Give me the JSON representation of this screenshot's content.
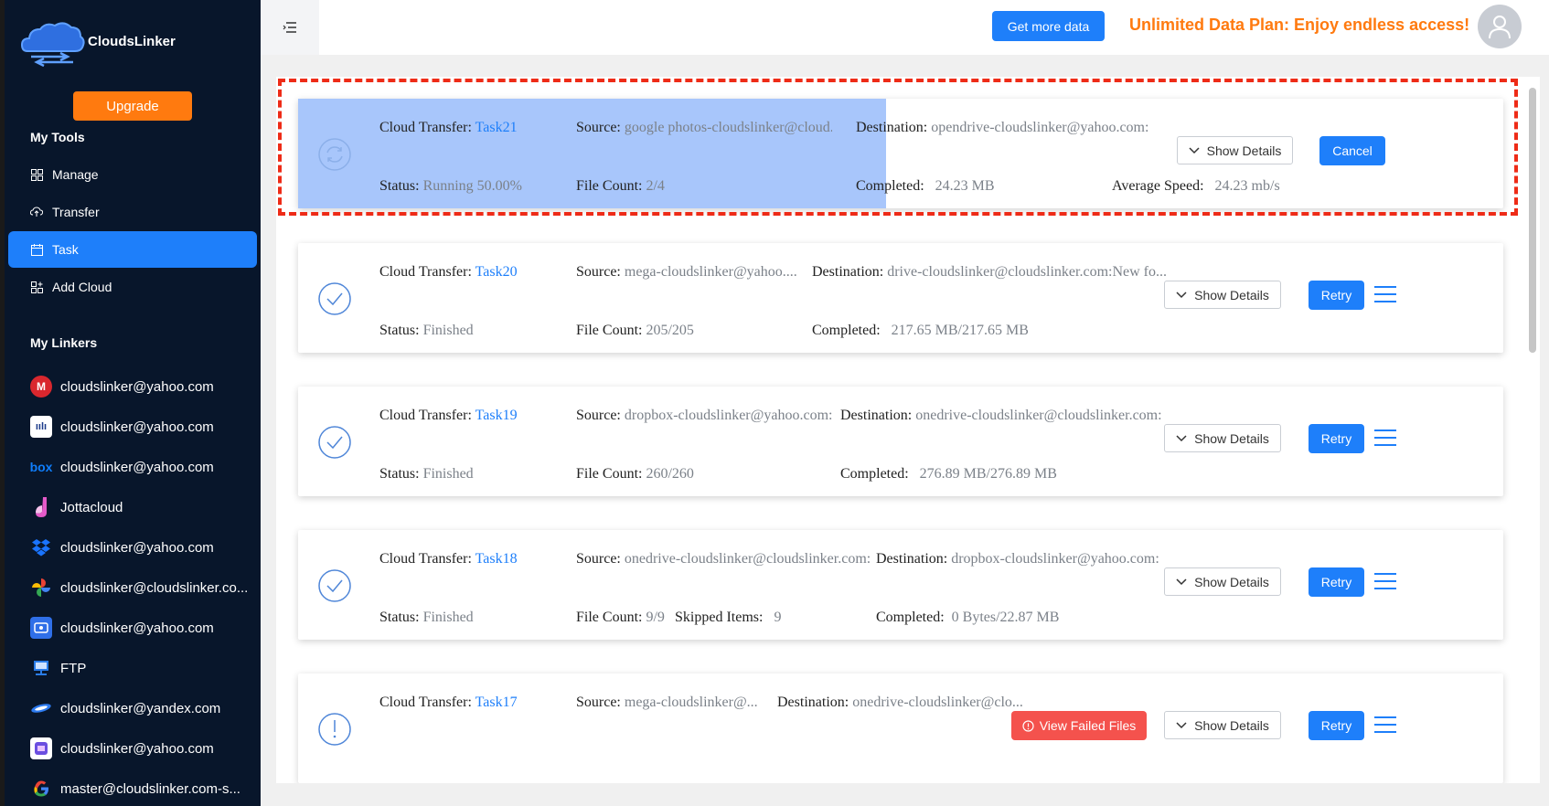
{
  "app": {
    "name": "CloudsLinker"
  },
  "sidebar": {
    "upgrade_label": "Upgrade",
    "tools_title": "My Tools",
    "tools": [
      {
        "label": "Manage",
        "icon": "grid-icon"
      },
      {
        "label": "Transfer",
        "icon": "cloud-transfer-icon"
      },
      {
        "label": "Task",
        "icon": "calendar-icon",
        "active": true
      },
      {
        "label": "Add Cloud",
        "icon": "add-grid-icon"
      }
    ],
    "linkers_title": "My Linkers",
    "linkers": [
      {
        "label": "cloudslinker@yahoo.com",
        "icon": "mega-icon"
      },
      {
        "label": "cloudslinker@yahoo.com",
        "icon": "pcloud-icon"
      },
      {
        "label": "cloudslinker@yahoo.com",
        "icon": "box-icon"
      },
      {
        "label": "Jottacloud",
        "icon": "jottacloud-icon"
      },
      {
        "label": "cloudslinker@yahoo.com",
        "icon": "dropbox-icon"
      },
      {
        "label": "cloudslinker@cloudslinker.co...",
        "icon": "google-photos-icon"
      },
      {
        "label": "cloudslinker@yahoo.com",
        "icon": "mediafire-icon"
      },
      {
        "label": "FTP",
        "icon": "ftp-icon"
      },
      {
        "label": "cloudslinker@yandex.com",
        "icon": "yandex-icon"
      },
      {
        "label": "cloudslinker@yahoo.com",
        "icon": "icedrive-icon"
      },
      {
        "label": "master@cloudslinker.com-s...",
        "icon": "google-icon"
      }
    ]
  },
  "header": {
    "get_data_label": "Get more data",
    "promo_text": "Unlimited Data Plan: Enjoy endless access!"
  },
  "labels": {
    "cloud_transfer": "Cloud Transfer:",
    "source": "Source:",
    "destination": "Destination:",
    "status": "Status:",
    "file_count": "File Count:",
    "completed": "Completed:",
    "average_speed": "Average Speed:",
    "skipped_items": "Skipped Items:",
    "show_details": "Show Details",
    "cancel": "Cancel",
    "retry": "Retry",
    "view_failed": "View Failed Files"
  },
  "tasks": [
    {
      "name": "Task21",
      "source": "google photos-cloudslinker@cloud...",
      "destination": "opendrive-cloudslinker@yahoo.com:",
      "status": "Running 50.00%",
      "file_count": "2/4",
      "completed": "24.23 MB",
      "average_speed": "24.23 mb/s",
      "state_icon": "sync-icon",
      "highlight_color": "#a8c6fb",
      "border_color": "#ee2b17"
    },
    {
      "name": "Task20",
      "source": "mega-cloudslinker@yahoo....",
      "destination": "drive-cloudslinker@cloudslinker.com:New fo...",
      "status": "Finished",
      "file_count": "205/205",
      "completed": "217.65 MB/217.65 MB",
      "state_icon": "check-circle-icon"
    },
    {
      "name": "Task19",
      "source": "dropbox-cloudslinker@yahoo.com:",
      "destination": "onedrive-cloudslinker@cloudslinker.com:",
      "status": "Finished",
      "file_count": "260/260",
      "completed": "276.89 MB/276.89 MB",
      "state_icon": "check-circle-icon"
    },
    {
      "name": "Task18",
      "source": "onedrive-cloudslinker@cloudslinker.com:",
      "destination": "dropbox-cloudslinker@yahoo.com:",
      "status": "Finished",
      "file_count": "9/9",
      "skipped_items": "9",
      "completed": "0 Bytes/22.87 MB",
      "state_icon": "check-circle-icon"
    },
    {
      "name": "Task17",
      "source": "mega-cloudslinker@...",
      "destination": "onedrive-cloudslinker@clo...",
      "state_icon": "warning-circle-icon"
    }
  ],
  "colors": {
    "accent": "#1e7ffa",
    "orange": "#ff7a0f",
    "sidebar_bg": "#08162b",
    "danger": "#f4524d"
  }
}
